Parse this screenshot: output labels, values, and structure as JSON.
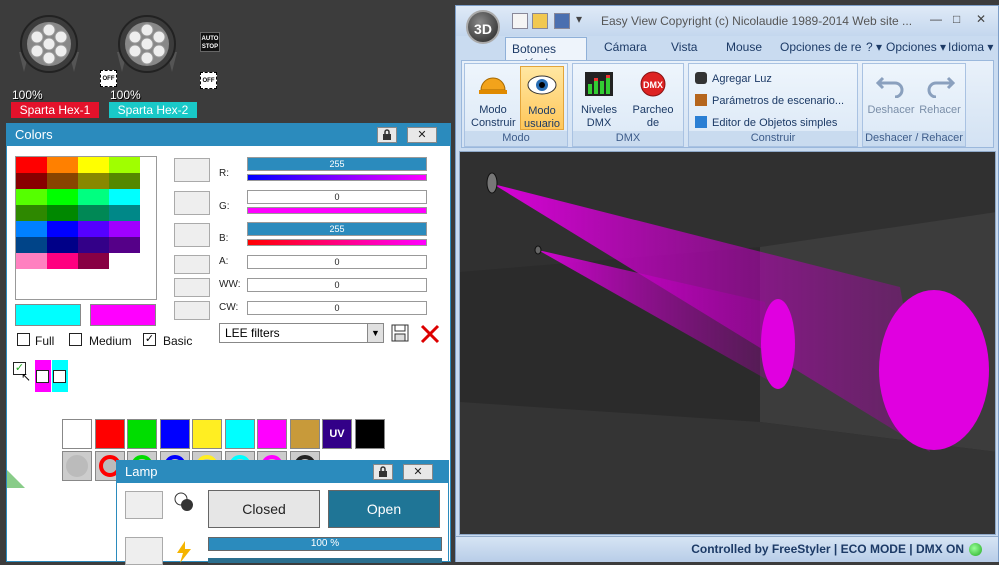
{
  "fixtures": [
    {
      "name": "Sparta Hex-1",
      "percent": "100%",
      "color": "#e3122b",
      "off_tag": "OFF"
    },
    {
      "name": "Sparta Hex-2",
      "percent": "100%",
      "color": "#19c9c8",
      "off_tag": "OFF"
    }
  ],
  "auto_stop": {
    "line1": "AUTO",
    "line2": "STOP",
    "off_tag": "OFF"
  },
  "colors_panel": {
    "title": "Colors",
    "lock_icon": "lock-icon",
    "close_label": "✕",
    "grid": [
      [
        "#ff0000",
        "#ff8000",
        "#ffff00",
        "#a0ff00"
      ],
      [
        "#880000",
        "#884400",
        "#888800",
        "#558800"
      ],
      [
        "#55ff00",
        "#00ff00",
        "#00ff80",
        "#00ffff"
      ],
      [
        "#2e8800",
        "#008800",
        "#008855",
        "#008888"
      ],
      [
        "#0080ff",
        "#0000ff",
        "#5500ff",
        "#a000ff"
      ],
      [
        "#004488",
        "#000088",
        "#330088",
        "#550088"
      ],
      [
        "#ff80c0",
        "#ff0080",
        "#880044",
        "#ffffff"
      ]
    ],
    "swatch_left": "#00ffff",
    "swatch_right": "#ff00ff",
    "options": [
      {
        "label": "Full",
        "checked": false
      },
      {
        "label": "Medium",
        "checked": false
      },
      {
        "label": "Basic",
        "checked": true
      }
    ],
    "channels": [
      {
        "label": "R:",
        "value": "255",
        "full": true,
        "strip": "linear-gradient(90deg,#0000ff,#ff00ff)"
      },
      {
        "label": "G:",
        "value": "0",
        "full": false,
        "strip": "linear-gradient(90deg,#ff00ff,#ff00ff)"
      },
      {
        "label": "B:",
        "value": "255",
        "full": true,
        "strip": "linear-gradient(90deg,#ff0000,#ff00ff)"
      },
      {
        "label": "A:",
        "value": "0",
        "full": false,
        "strip": ""
      },
      {
        "label": "WW:",
        "value": "0",
        "full": false,
        "strip": ""
      },
      {
        "label": "CW:",
        "value": "0",
        "full": false,
        "strip": ""
      }
    ],
    "filter_select": "LEE filters",
    "palette": [
      "#ffffff",
      "#ff0000",
      "#00dd00",
      "#0000ff",
      "#ffee22",
      "#00ffff",
      "#ff00ff",
      "#c89a3a",
      "#330088",
      "#000000"
    ],
    "uv_label": "UV",
    "rings": [
      "#bbbbbb",
      "#ff0000",
      "#00dd00",
      "#0000ff",
      "#ffee22",
      "#00ffff",
      "#ff00ff",
      "#222222"
    ]
  },
  "lamp_panel": {
    "title": "Lamp",
    "closed_label": "Closed",
    "open_label": "Open",
    "progress": "100 %",
    "progress_value": 100
  },
  "easy_view": {
    "title": "Easy View   Copyright (c) Nicolaudie 1989-2014   Web site ...",
    "logo": "3D",
    "tabs": [
      "Botones estánd",
      "Cámara",
      "Vista",
      "Mouse",
      "Opciones de re",
      "? ▾",
      "Opciones ▾",
      "Idioma ▾"
    ],
    "groups": {
      "modo": {
        "label": "Modo",
        "btn1": "Modo Construir",
        "btn2": "Modo usuario"
      },
      "dmx": {
        "label": "DMX",
        "btn1": "Niveles DMX",
        "btn2": "Parcheo de Universos"
      },
      "construir": {
        "label": "Construir",
        "items": [
          "Agregar Luz",
          "Parámetros de escenario...",
          "Editor de Objetos simples"
        ]
      },
      "deshacer": {
        "label": "Deshacer / Rehacer",
        "undo": "Deshacer",
        "redo": "Rehacer"
      }
    },
    "status": "Controlled by FreeStyler   |   ECO MODE   |   DMX ON"
  }
}
